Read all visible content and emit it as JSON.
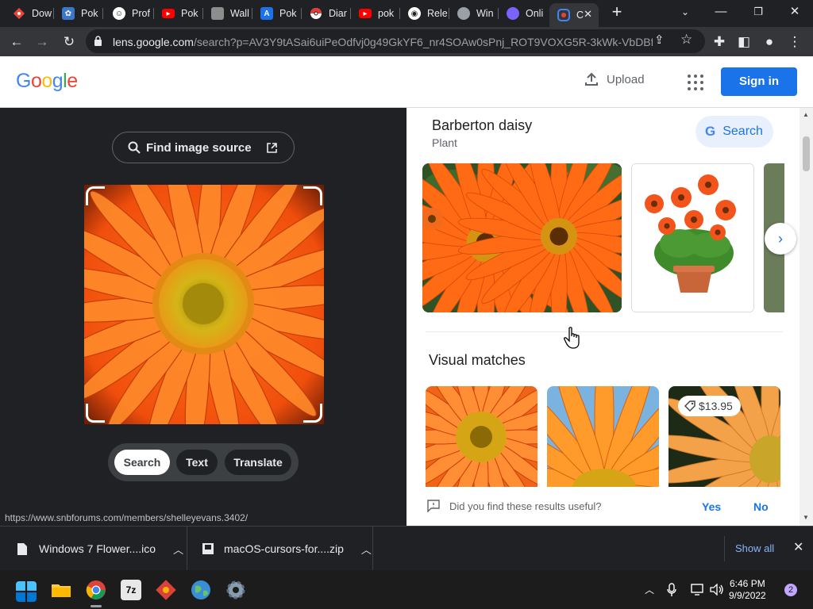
{
  "browser": {
    "tabs": [
      {
        "title": "Dow",
        "icon": "diamond-icon",
        "color": "#e8453c"
      },
      {
        "title": "Pok",
        "icon": "gear-icon",
        "color": "#5f6368"
      },
      {
        "title": "Prof",
        "icon": "smiley-icon",
        "color": "#202124"
      },
      {
        "title": "Pok",
        "icon": "youtube-icon",
        "color": "#ff0000"
      },
      {
        "title": "Wall",
        "icon": "car-icon",
        "color": "#777777"
      },
      {
        "title": "Pok",
        "icon": "font-icon",
        "color": "#1a73e8"
      },
      {
        "title": "Diar",
        "icon": "pokeball-icon",
        "color": "#e53935"
      },
      {
        "title": "pok",
        "icon": "youtube-icon",
        "color": "#ff0000"
      },
      {
        "title": "Rele",
        "icon": "github-icon",
        "color": "#ffffff"
      },
      {
        "title": "Win",
        "icon": "globe-icon",
        "color": "#9aa0a6"
      },
      {
        "title": "Onli",
        "icon": "circle-icon",
        "color": "#7b61ff"
      },
      {
        "title": "C",
        "icon": "lens-icon",
        "color": "#4285f4"
      }
    ],
    "url_host": "lens.google.com",
    "url_path": "/search?p=AV3Y9tASai6uiPeOdfvj0g49GkYF6_nr4SOAw0sPnj_ROT9VOXG5R-3kWk-VbDBfdJ..."
  },
  "google_header": {
    "logo": "Google",
    "upload_label": "Upload",
    "signin_label": "Sign in"
  },
  "lens": {
    "find_source_label": "Find image source",
    "modes": [
      "Search",
      "Text",
      "Translate"
    ],
    "active_mode": "Search"
  },
  "results": {
    "entity_title": "Barberton daisy",
    "entity_subtitle": "Plant",
    "search_button": "Search",
    "visual_matches_heading": "Visual matches",
    "price_badge": "$13.95",
    "feedback_question": "Did you find these results useful?",
    "feedback_yes": "Yes",
    "feedback_no": "No"
  },
  "status_url": "https://www.snbforums.com/members/shelleyevans.3402/",
  "downloads": {
    "items": [
      {
        "name": "Windows 7 Flower....ico"
      },
      {
        "name": "macOS-cursors-for....zip"
      }
    ],
    "show_all_label": "Show all"
  },
  "taskbar": {
    "time": "6:46 PM",
    "date": "9/9/2022",
    "notification_count": "2"
  },
  "colors": {
    "accent": "#1a73e8",
    "link": "#1a73e8",
    "dark_bg": "#202124"
  }
}
